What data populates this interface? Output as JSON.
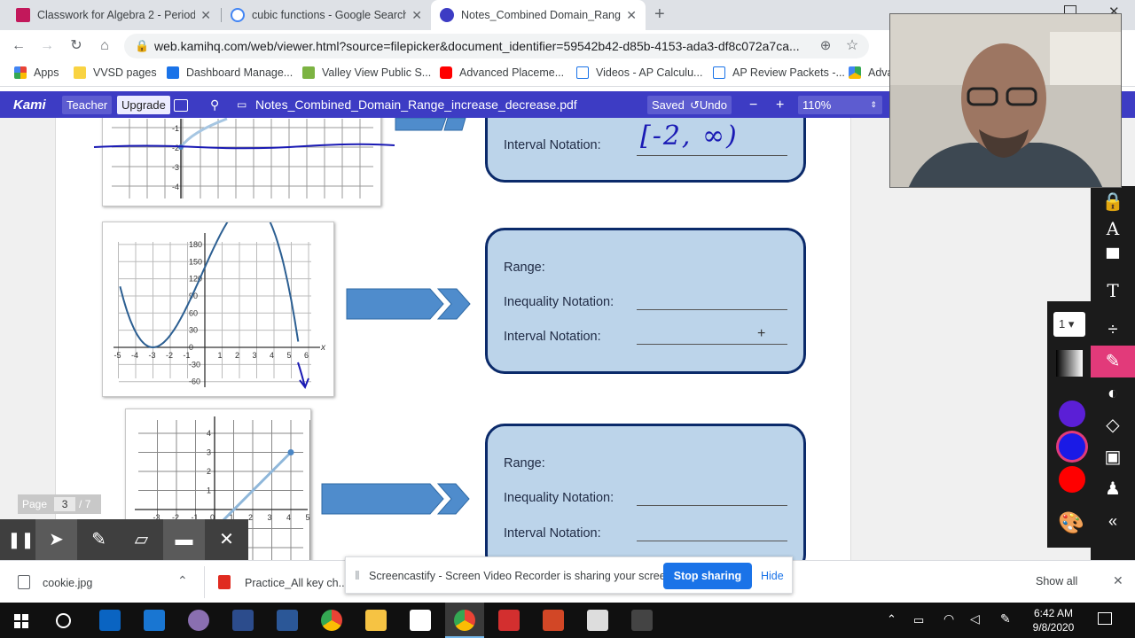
{
  "tabs": [
    {
      "title": "Classwork for Algebra 2 - Period",
      "favicon_color": "#c2185b"
    },
    {
      "title": "cubic functions - Google Search",
      "favicon_color": "#4285f4"
    },
    {
      "title": "Notes_Combined Domain_Range",
      "favicon_color": "#3d3cc4",
      "active": true
    }
  ],
  "new_tab_icon": "+",
  "url": "web.kamihq.com/web/viewer.html?source=filepicker&document_identifier=59542b42-d85b-4153-ada3-df8c072a7ca...",
  "bookmarks": [
    {
      "label": "Apps",
      "color": "#ea4335"
    },
    {
      "label": "VVSD pages",
      "color": "#f9d342"
    },
    {
      "label": "Dashboard Manage...",
      "color": "#1a73e8"
    },
    {
      "label": "Valley View Public S...",
      "color": "#7cb342"
    },
    {
      "label": "Advanced Placeme...",
      "color": "#ff0000"
    },
    {
      "label": "Videos - AP Calculu...",
      "color": "#1a73e8"
    },
    {
      "label": "AP Review Packets -...",
      "color": "#1a73e8"
    },
    {
      "label": "Adva",
      "color": "#34a853"
    }
  ],
  "kami": {
    "logo": "Kami",
    "teacher": "Teacher",
    "upgrade": "Upgrade",
    "filename": "Notes_Combined_Domain_Range_increase_decrease.pdf",
    "saved": "Saved",
    "undo": "Undo",
    "minus": "−",
    "plus": "+",
    "zoom": "110%"
  },
  "cards": [
    {
      "interval_label": "Interval Notation:",
      "handwritten": "[-2, ∞)"
    },
    {
      "range_label": "Range:",
      "inequality_label": "Inequality Notation:",
      "interval_label": "Interval Notation:"
    },
    {
      "range_label": "Range:",
      "inequality_label": "Inequality Notation:",
      "interval_label": "Interval Notation:"
    }
  ],
  "graph1": {
    "y_ticks": [
      "-1",
      "-2",
      "-3",
      "-4"
    ]
  },
  "graph2": {
    "y_ticks": [
      "180",
      "150",
      "120",
      "90",
      "60",
      "30",
      "0",
      "-30",
      "-60"
    ],
    "x_ticks": [
      "-5",
      "-4",
      "-3",
      "-2",
      "-1",
      "0",
      "1",
      "2",
      "3",
      "4",
      "5",
      "6"
    ],
    "x_axis_letter": "x"
  },
  "graph3": {
    "y_ticks": [
      "4",
      "3",
      "2",
      "1",
      "0"
    ],
    "x_ticks": [
      "-3",
      "-2",
      "-1",
      "0",
      "1",
      "2",
      "3",
      "4",
      "5"
    ]
  },
  "page_widget": {
    "label": "Page",
    "current": "3",
    "total": "/ 7"
  },
  "palette": {
    "page_select": "1",
    "colors": [
      "#5b1fd6",
      "#1a1ae6",
      "#ff0000"
    ]
  },
  "downloads": {
    "item1": "cookie.jpg",
    "item2": "Practice_All key ch....p",
    "show_all": "Show all"
  },
  "share_bar": {
    "message": "Screencastify - Screen Video Recorder is sharing your screen.",
    "stop": "Stop sharing",
    "hide": "Hide"
  },
  "clock": {
    "time": "6:42 AM",
    "date": "9/8/2020"
  }
}
